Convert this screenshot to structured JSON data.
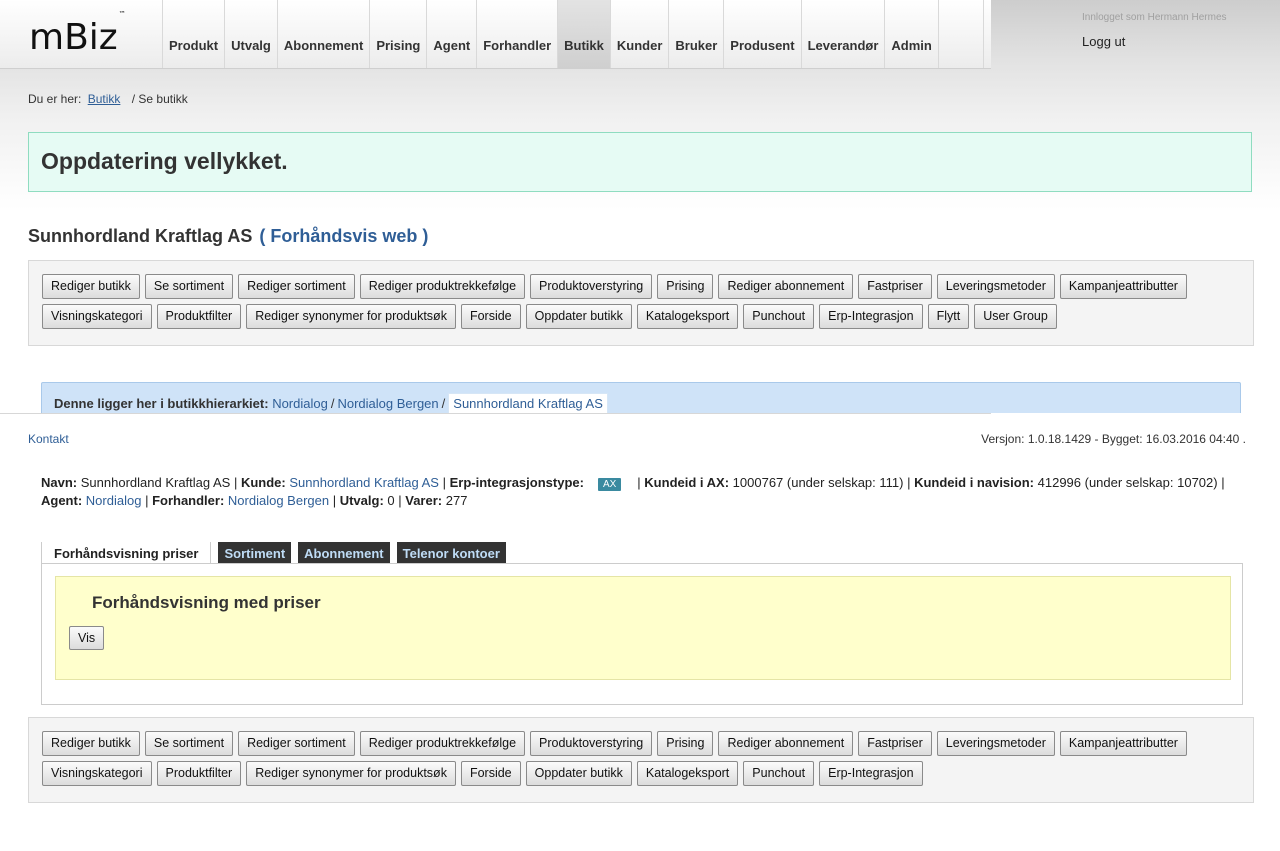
{
  "header": {
    "logo": "mBiz",
    "logo_tm": "™",
    "nav": [
      "Produkt",
      "Utvalg",
      "Abonnement",
      "Prising",
      "Agent",
      "Forhandler",
      "Butikk",
      "Kunder",
      "Bruker",
      "Produsent",
      "Leverandør",
      "Admin"
    ],
    "active_nav": "Butikk",
    "logged_in_as": "Innlogget som Hermann Hermes",
    "logout": "Logg ut"
  },
  "breadcrumb": {
    "prefix": "Du er her:",
    "link": "Butikk",
    "current": "/ Se butikk"
  },
  "success_message": "Oppdatering vellykket.",
  "store": {
    "name": "Sunnhordland Kraftlag AS",
    "preview_link": "( Forhåndsvis web )"
  },
  "toolbar_top": {
    "row1": [
      "Rediger butikk",
      "Se sortiment",
      "Rediger sortiment",
      "Rediger produktrekkefølge",
      "Produktoverstyring",
      "Prising",
      "Rediger abonnement",
      "Fastpriser",
      "Leveringsmetoder",
      "Kampanjeattributter"
    ],
    "row2": [
      "Visningskategori",
      "Produktfilter",
      "Rediger synonymer for produktsøk",
      "Forside",
      "Oppdater butikk",
      "Katalogeksport",
      "Punchout",
      "Erp-Integrasjon",
      "Flytt",
      "User Group"
    ]
  },
  "toolbar_bottom": {
    "row1": [
      "Rediger butikk",
      "Se sortiment",
      "Rediger sortiment",
      "Rediger produktrekkefølge",
      "Produktoverstyring",
      "Prising",
      "Rediger abonnement",
      "Fastpriser",
      "Leveringsmetoder",
      "Kampanjeattributter"
    ],
    "row2": [
      "Visningskategori",
      "Produktfilter",
      "Rediger synonymer for produktsøk",
      "Forside",
      "Oppdater butikk",
      "Katalogeksport",
      "Punchout",
      "Erp-Integrasjon"
    ]
  },
  "hierarchy": {
    "label": "Denne ligger her i butikkhierarkiet:",
    "path": [
      "Nordialog",
      "Nordialog Bergen"
    ],
    "current": "Sunnhordland Kraftlag AS"
  },
  "footer": {
    "contact": "Kontakt",
    "version": "Versjon: 1.0.18.1429 - Bygget: 16.03.2016 04:40 ."
  },
  "info": {
    "name_label": "Navn:",
    "name_value": "Sunnhordland Kraftlag AS",
    "customer_label": "Kunde:",
    "customer_value": "Sunnhordland Kraftlag AS",
    "erp_label": "Erp-integrasjonstype:",
    "erp_badge": "AX",
    "ax_label": "Kundeid i AX:",
    "ax_value": "1000767 (under selskap: 111)",
    "nav_label": "Kundeid i navision:",
    "nav_value": "412996 (under selskap: 10702)",
    "agent_label": "Agent:",
    "agent_value": "Nordialog",
    "dealer_label": "Forhandler:",
    "dealer_value": "Nordialog Bergen",
    "selection_label": "Utvalg:",
    "selection_value": "0",
    "items_label": "Varer:",
    "items_value": "277"
  },
  "tabs": [
    "Forhåndsvisning priser",
    "Sortiment",
    "Abonnement",
    "Telenor kontoer"
  ],
  "preview_panel": {
    "title": "Forhåndsvisning med priser",
    "button": "Vis"
  }
}
